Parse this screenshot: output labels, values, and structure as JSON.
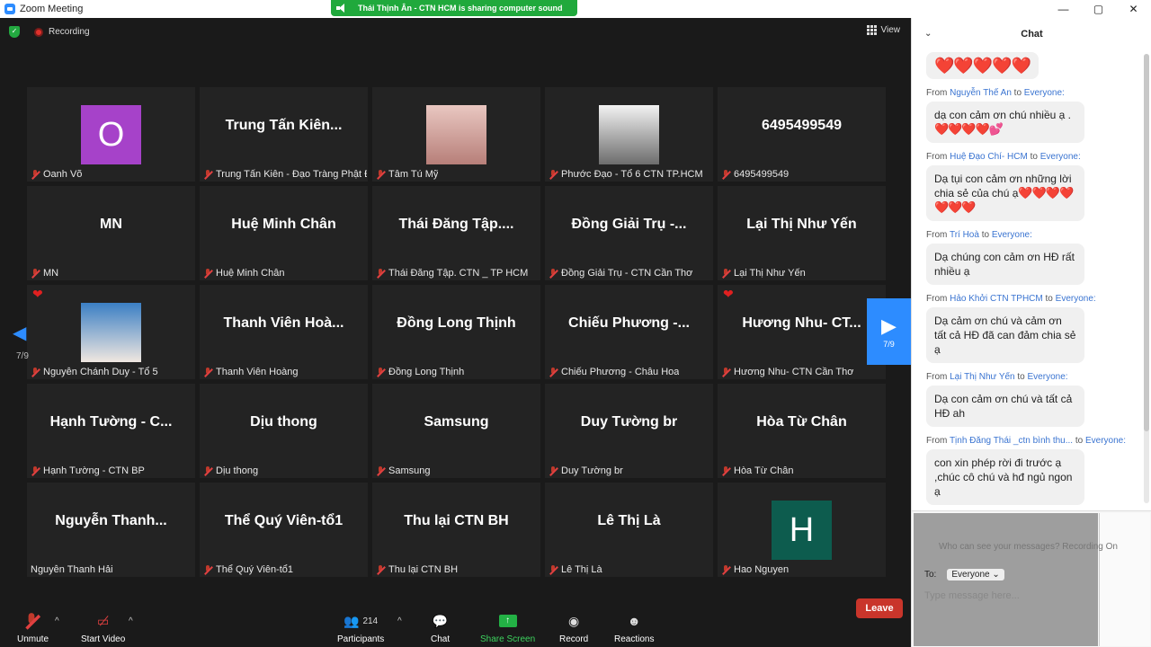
{
  "window": {
    "title": "Zoom Meeting",
    "min": "—",
    "max": "▢",
    "close": "✕"
  },
  "share_banner": {
    "text": "Thái Thịnh Ân - CTN HCM is sharing computer sound"
  },
  "topbar": {
    "recording": "Recording",
    "view": "View"
  },
  "tiles": [
    {
      "big": "",
      "label": "Oanh Võ",
      "avatar": "O",
      "avatar_color": "#a642c9"
    },
    {
      "big": "Trung Tấn Kiên...",
      "label": "Trung Tấn Kiên - Đạo Tràng Phật Đ..."
    },
    {
      "big": "",
      "label": "Tâm Tú Mỹ",
      "photo": "girl"
    },
    {
      "big": "",
      "label": "Phước Đạo - Tổ 6 CTN TP.HCM",
      "photo": "boy"
    },
    {
      "big": "6495499549",
      "label": "6495499549"
    },
    {
      "big": "MN",
      "label": "MN"
    },
    {
      "big": "Huệ Minh Chân",
      "label": "Huệ Minh Chân"
    },
    {
      "big": "Thái Đăng Tập....",
      "label": "Thái Đăng Tập. CTN _ TP HCM"
    },
    {
      "big": "Đồng Giải Trụ -...",
      "label": "Đồng Giải Trụ - CTN Cần Thơ"
    },
    {
      "big": "Lại Thị Như Yến",
      "label": "Lại Thị Như Yến"
    },
    {
      "big": "",
      "label": "Nguyễn Chánh Duy - Tổ 5",
      "photo": "man",
      "heart": true
    },
    {
      "big": "Thanh Viên Hoà...",
      "label": "Thanh Viên Hoàng"
    },
    {
      "big": "Đồng Long Thịnh",
      "label": "Đồng Long Thịnh"
    },
    {
      "big": "Chiếu Phương -...",
      "label": "Chiếu Phương - Châu Hoa"
    },
    {
      "big": "Hương Nhu- CT...",
      "label": "Hương Nhu- CTN Cần Thơ",
      "heart": true
    },
    {
      "big": "Hạnh Tường - C...",
      "label": "Hạnh Tường - CTN BP"
    },
    {
      "big": "Dịu thong",
      "label": "Dịu thong"
    },
    {
      "big": "Samsung",
      "label": "Samsung"
    },
    {
      "big": "Duy Tường br",
      "label": "Duy Tường br"
    },
    {
      "big": "Hòa Từ Chân",
      "label": "Hòa Từ Chân"
    },
    {
      "big": "Nguyễn Thanh...",
      "label": "Nguyễn Thanh Hải",
      "nomic": true
    },
    {
      "big": "Thể Quý Viên-tổ1",
      "label": "Thể Quý Viên-tổ1"
    },
    {
      "big": "Thu lại CTN BH",
      "label": "Thu lại CTN BH"
    },
    {
      "big": "Lê Thị Là",
      "label": "Lê Thị Là"
    },
    {
      "big": "",
      "label": "Hao Nguyen",
      "avatar": "H",
      "avatar_color": "#0d5c4e"
    }
  ],
  "pager": {
    "left": "7/9",
    "right": "7/9"
  },
  "toolbar": {
    "unmute": "Unmute",
    "start_video": "Start Video",
    "participants": "Participants",
    "participants_count": "214",
    "chat": "Chat",
    "share_screen": "Share Screen",
    "record": "Record",
    "reactions": "Reactions",
    "leave": "Leave"
  },
  "chat": {
    "title": "Chat",
    "hearts_top": "❤️❤️❤️❤️❤️",
    "messages": [
      {
        "from": "Nguyễn Thế An",
        "to": "Everyone:",
        "text": "dạ con cảm ơn chú nhiều ạ .",
        "hearts": "❤️❤️❤️❤️💕"
      },
      {
        "from": "Huệ Đạo Chí-  HCM",
        "to": "Everyone:",
        "text": "Dạ tụi con cảm ơn những lời chia sẻ của chú ạ",
        "hearts": "❤️❤️❤️❤️❤️❤️❤️"
      },
      {
        "from": "Trí Hoà",
        "to": "Everyone:",
        "text": "Dạ chúng con cảm ơn HĐ rất nhiều ạ",
        "hearts": ""
      },
      {
        "from": "Hảo Khởi CTN TPHCM",
        "to": "Everyone:",
        "text": "Dạ cảm ơn chú và cảm ơn tất cả HĐ đã can đảm chia sẻ ạ",
        "hearts": ""
      },
      {
        "from": "Lại Thị Như Yến",
        "to": "Everyone:",
        "text": "Dạ con cảm ơn chú và tất cả HĐ ah",
        "hearts": ""
      },
      {
        "from": "Tịnh Đăng Thái _ctn bình thu...",
        "to": "Everyone:",
        "text": "con xin phép rời đi trước ạ ,chúc cô chú và hđ ngủ ngon ạ",
        "hearts": ""
      }
    ],
    "from_word": "From",
    "to_word": "to",
    "who_can_see": "Who can see your messages? Recording On",
    "to_label": "To:",
    "to_value": "Everyone",
    "placeholder": "Type message here..."
  }
}
